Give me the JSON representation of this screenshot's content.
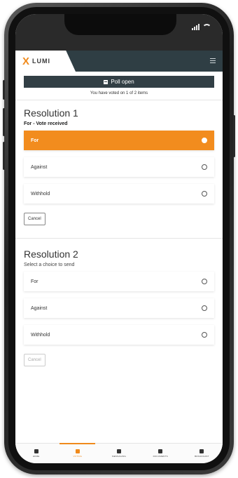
{
  "brand": {
    "logo_mark": "X",
    "name": "LUMI"
  },
  "poll": {
    "status_label": "Poll open",
    "voted_text": "You have voted on 1 of 2 items"
  },
  "resolutions": [
    {
      "title": "Resolution 1",
      "status": "For - Vote received",
      "options": [
        "For",
        "Against",
        "Withhold"
      ],
      "selected": "For",
      "cancel_label": "Cancel"
    },
    {
      "title": "Resolution 2",
      "status": "Select a choice to send",
      "options": [
        "For",
        "Against",
        "Withhold"
      ],
      "selected": null,
      "cancel_label": "Cancel"
    }
  ],
  "nav": {
    "items": [
      {
        "label": "HOME",
        "icon": "home-icon"
      },
      {
        "label": "VOTING",
        "icon": "voting-icon",
        "active": true
      },
      {
        "label": "MESSAGING",
        "icon": "messaging-icon"
      },
      {
        "label": "DOCUMENTS",
        "icon": "documents-icon"
      },
      {
        "label": "BROADCAST",
        "icon": "broadcast-icon"
      }
    ]
  },
  "colors": {
    "accent": "#f28c1e",
    "header": "#2f3e44",
    "poll_bar": "#323f45"
  }
}
